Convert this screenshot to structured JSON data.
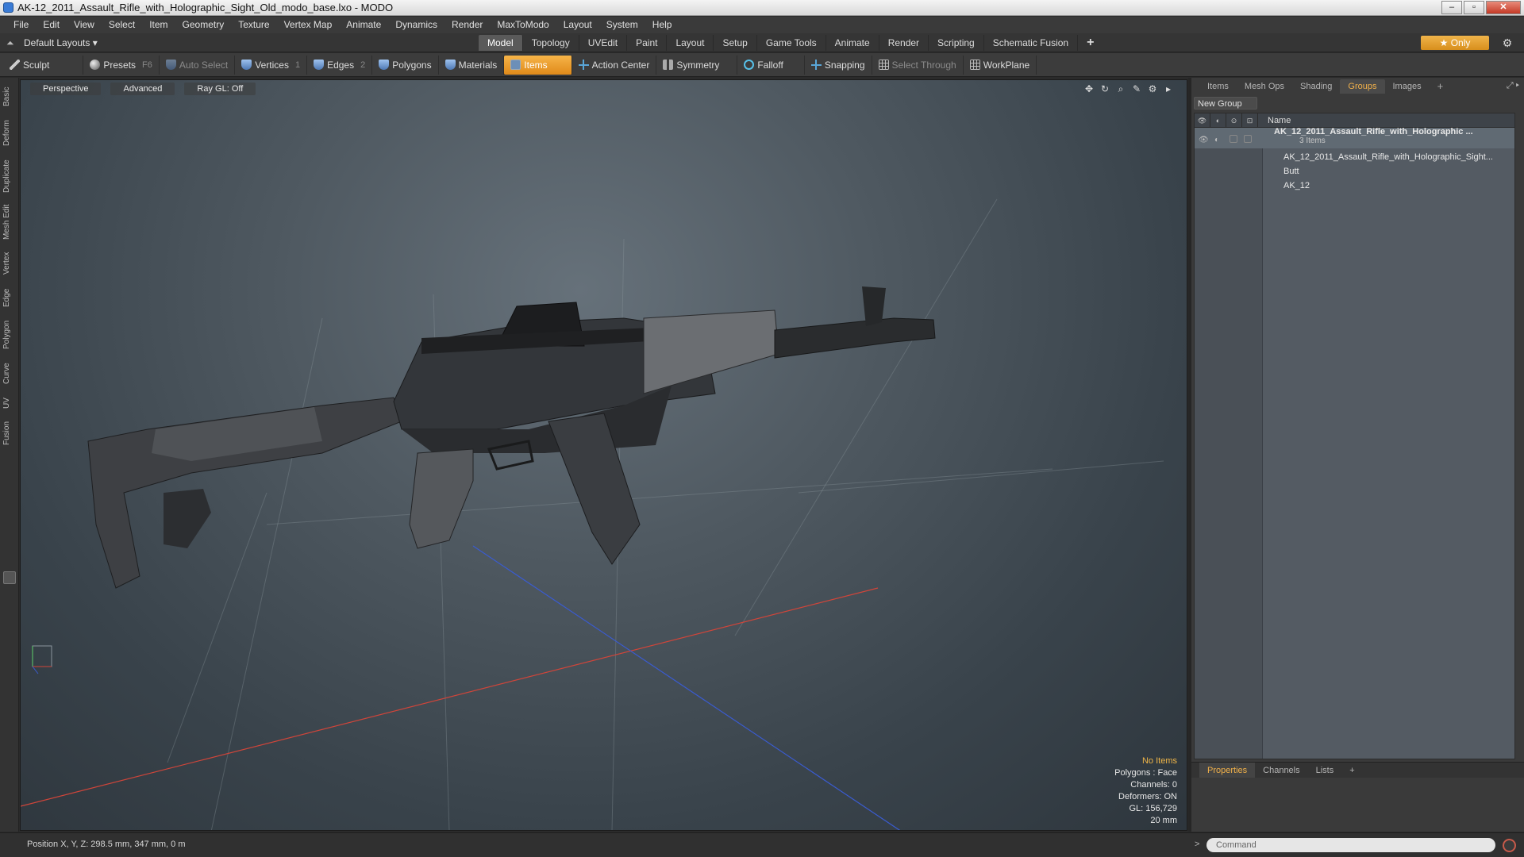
{
  "window": {
    "title": "AK-12_2011_Assault_Rifle_with_Holographic_Sight_Old_modo_base.lxo - MODO",
    "controls": [
      "–",
      "▫",
      "✕"
    ]
  },
  "menu": [
    "File",
    "Edit",
    "View",
    "Select",
    "Item",
    "Geometry",
    "Texture",
    "Vertex Map",
    "Animate",
    "Dynamics",
    "Render",
    "MaxToModo",
    "Layout",
    "System",
    "Help"
  ],
  "layout": {
    "selector": "Default Layouts ▾",
    "tabs": [
      "Model",
      "Topology",
      "UVEdit",
      "Paint",
      "Layout",
      "Setup",
      "Game Tools",
      "Animate",
      "Render",
      "Scripting",
      "Schematic Fusion"
    ],
    "active_tab": "Model",
    "add_tab": "+",
    "only_label": "★  Only",
    "settings_icon": "gear-icon"
  },
  "toolbar": {
    "sculpt": "Sculpt",
    "presets": "Presets",
    "presets_key": "F6",
    "auto_select": "Auto Select",
    "vertices": "Vertices",
    "vertices_key": "1",
    "edges": "Edges",
    "edges_key": "2",
    "polygons": "Polygons",
    "materials": "Materials",
    "items": "Items",
    "action_center": "Action Center",
    "symmetry": "Symmetry",
    "falloff": "Falloff",
    "snapping": "Snapping",
    "select_through": "Select Through",
    "workplane": "WorkPlane"
  },
  "left_tabs": [
    "Basic",
    "Deform",
    "Duplicate",
    "Mesh Edit",
    "Vertex",
    "Edge",
    "Polygon",
    "Curve",
    "UV",
    "Fusion"
  ],
  "viewport": {
    "view": "Perspective",
    "shading": "Advanced",
    "raygl": "Ray GL: Off",
    "tools": [
      "✥",
      "↻",
      "⌕",
      "✎",
      "⚙",
      "▸"
    ],
    "info": {
      "selection": "No Items",
      "polygons": "Polygons : Face",
      "channels": "Channels: 0",
      "deformers": "Deformers: ON",
      "gl": "GL: 156,729",
      "scale": "20 mm"
    }
  },
  "right_panel": {
    "tabs": [
      "Items",
      "Mesh Ops",
      "Shading",
      "Groups",
      "Images"
    ],
    "active_tab": "Groups",
    "add_tab": "+",
    "new_group": "New Group",
    "column_name": "Name",
    "group": {
      "name": "AK_12_2011_Assault_Rifle_with_Holographic ...",
      "count": "3 Items",
      "children": [
        "AK_12_2011_Assault_Rifle_with_Holographic_Sight...",
        "Butt",
        "AK_12"
      ]
    }
  },
  "bottom_panel": {
    "tabs": [
      "Properties",
      "Channels",
      "Lists"
    ],
    "active_tab": "Properties",
    "add_tab": "+"
  },
  "status": {
    "position": "Position X, Y, Z:   298.5 mm, 347 mm, 0 m",
    "command_placeholder": "Command",
    "command_arrow": ">"
  },
  "colors": {
    "accent": "#f0b04a",
    "axis_x": "#d0453a",
    "axis_z": "#3a5bd0"
  }
}
